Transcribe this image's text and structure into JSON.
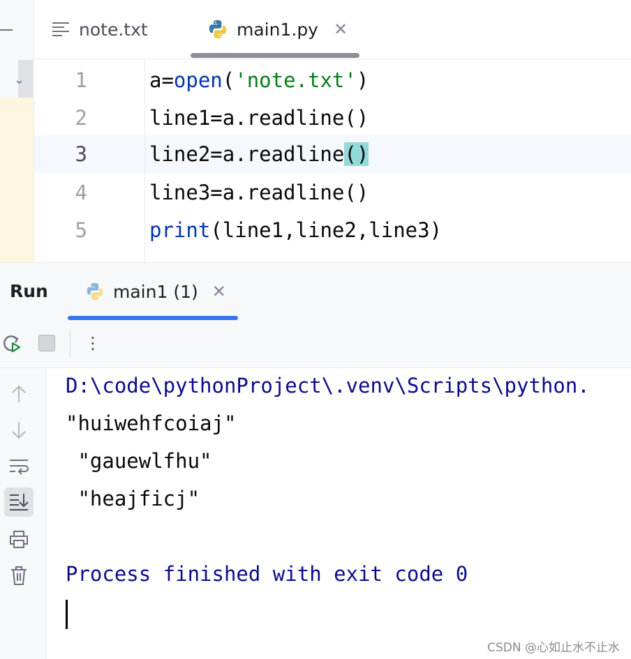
{
  "editor": {
    "tabs": [
      {
        "label": "note.txt",
        "icon": "text-file-icon"
      },
      {
        "label": "main1.py",
        "icon": "python-icon",
        "active": true
      }
    ],
    "lines": [
      {
        "number": "1"
      },
      {
        "number": "2"
      },
      {
        "number": "3",
        "current": true
      },
      {
        "number": "4"
      },
      {
        "number": "5"
      }
    ],
    "code": {
      "l1_a": "a=",
      "l1_kw": "open",
      "l1_p1": "(",
      "l1_str": "'note.txt'",
      "l1_p2": ")",
      "l2": "line1=a.readline()",
      "l3_text": "line2=a.readline",
      "l3_paren": "()",
      "l4": "line3=a.readline()",
      "l5_kw": "print",
      "l5_rest": "(line1,line2,line3)"
    }
  },
  "run_panel": {
    "title": "Run",
    "tab_label": "main1 (1)"
  },
  "console": {
    "lines": [
      "D:\\code\\pythonProject\\.venv\\Scripts\\python.",
      "\"huiwehfcoiaj\"",
      " \"gauewlfhu\"",
      " \"heajficj\"",
      "",
      "Process finished with exit code 0"
    ]
  },
  "watermark": "CSDN @心如止水不止水",
  "colors": {
    "keyword": "#0033b3",
    "string": "#067d17",
    "console_blue": "#0b0b8a",
    "accent": "#3574f0",
    "brace_highlight": "#93d9d9"
  }
}
